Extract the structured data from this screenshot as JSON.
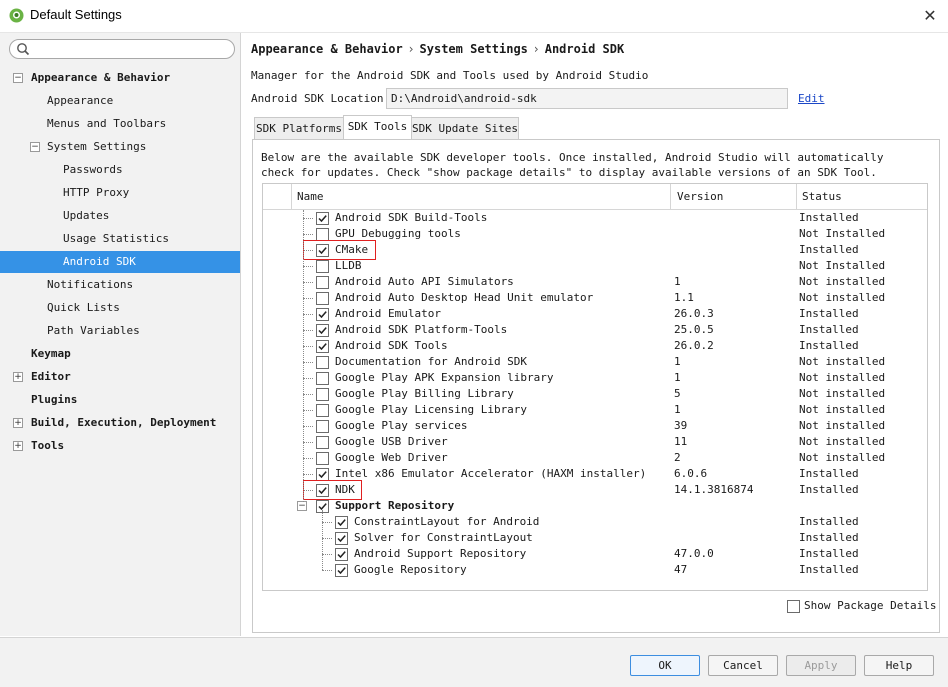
{
  "window": {
    "title": "Default Settings",
    "close_glyph": "✕"
  },
  "sidebar": {
    "search_placeholder": "",
    "items": [
      {
        "label": "Appearance & Behavior",
        "indent": 0,
        "bold": true,
        "expander": "−"
      },
      {
        "label": "Appearance",
        "indent": 1
      },
      {
        "label": "Menus and Toolbars",
        "indent": 1
      },
      {
        "label": "System Settings",
        "indent": 1,
        "expander": "−"
      },
      {
        "label": "Passwords",
        "indent": 2
      },
      {
        "label": "HTTP Proxy",
        "indent": 2
      },
      {
        "label": "Updates",
        "indent": 2
      },
      {
        "label": "Usage Statistics",
        "indent": 2
      },
      {
        "label": "Android SDK",
        "indent": 2,
        "selected": true
      },
      {
        "label": "Notifications",
        "indent": 1
      },
      {
        "label": "Quick Lists",
        "indent": 1
      },
      {
        "label": "Path Variables",
        "indent": 1
      },
      {
        "label": "Keymap",
        "indent": 0,
        "bold": true
      },
      {
        "label": "Editor",
        "indent": 0,
        "bold": true,
        "expander": "+"
      },
      {
        "label": "Plugins",
        "indent": 0,
        "bold": true
      },
      {
        "label": "Build, Execution, Deployment",
        "indent": 0,
        "bold": true,
        "expander": "+"
      },
      {
        "label": "Tools",
        "indent": 0,
        "bold": true,
        "expander": "+"
      }
    ]
  },
  "breadcrumb": [
    "Appearance & Behavior",
    "System Settings",
    "Android SDK"
  ],
  "breadcrumb_sep": "›",
  "description": "Manager for the Android SDK and Tools used by Android Studio",
  "sdk_location": {
    "label": "Android SDK Location:",
    "value": "D:\\Android\\android-sdk",
    "edit": "Edit"
  },
  "tabs": [
    {
      "label": "SDK Platforms",
      "active": false
    },
    {
      "label": "SDK Tools",
      "active": true
    },
    {
      "label": "SDK Update Sites",
      "active": false
    }
  ],
  "panel_desc": [
    "Below are the available SDK developer tools. Once installed, Android Studio will automatically",
    "check for updates. Check \"show package details\" to display available versions of an SDK Tool."
  ],
  "table": {
    "headers": {
      "name": "Name",
      "version": "Version",
      "status": "Status"
    },
    "rows": [
      {
        "name": "Android SDK Build-Tools",
        "version": "",
        "status": "Installed",
        "checked": true,
        "level": 0
      },
      {
        "name": "GPU Debugging tools",
        "version": "",
        "status": "Not Installed",
        "checked": false,
        "level": 0
      },
      {
        "name": "CMake",
        "version": "",
        "status": "Installed",
        "checked": true,
        "level": 0,
        "highlight": true
      },
      {
        "name": "LLDB",
        "version": "",
        "status": "Not Installed",
        "checked": false,
        "level": 0
      },
      {
        "name": "Android Auto API Simulators",
        "version": "1",
        "status": "Not installed",
        "checked": false,
        "level": 0
      },
      {
        "name": "Android Auto Desktop Head Unit emulator",
        "version": "1.1",
        "status": "Not installed",
        "checked": false,
        "level": 0
      },
      {
        "name": "Android Emulator",
        "version": "26.0.3",
        "status": "Installed",
        "checked": true,
        "level": 0
      },
      {
        "name": "Android SDK Platform-Tools",
        "version": "25.0.5",
        "status": "Installed",
        "checked": true,
        "level": 0
      },
      {
        "name": "Android SDK Tools",
        "version": "26.0.2",
        "status": "Installed",
        "checked": true,
        "level": 0
      },
      {
        "name": "Documentation for Android SDK",
        "version": "1",
        "status": "Not installed",
        "checked": false,
        "level": 0
      },
      {
        "name": "Google Play APK Expansion library",
        "version": "1",
        "status": "Not installed",
        "checked": false,
        "level": 0
      },
      {
        "name": "Google Play Billing Library",
        "version": "5",
        "status": "Not installed",
        "checked": false,
        "level": 0
      },
      {
        "name": "Google Play Licensing Library",
        "version": "1",
        "status": "Not installed",
        "checked": false,
        "level": 0
      },
      {
        "name": "Google Play services",
        "version": "39",
        "status": "Not installed",
        "checked": false,
        "level": 0
      },
      {
        "name": "Google USB Driver",
        "version": "11",
        "status": "Not installed",
        "checked": false,
        "level": 0
      },
      {
        "name": "Google Web Driver",
        "version": "2",
        "status": "Not installed",
        "checked": false,
        "level": 0
      },
      {
        "name": "Intel x86 Emulator Accelerator (HAXM installer)",
        "version": "6.0.6",
        "status": "Installed",
        "checked": true,
        "level": 0
      },
      {
        "name": "NDK",
        "version": "14.1.3816874",
        "status": "Installed",
        "checked": true,
        "level": 0,
        "highlight": true
      },
      {
        "name": "Support Repository",
        "version": "",
        "status": "",
        "checked": true,
        "level": 0,
        "bold": true,
        "expander": "−"
      },
      {
        "name": "ConstraintLayout for Android",
        "version": "",
        "status": "Installed",
        "checked": true,
        "level": 1
      },
      {
        "name": "Solver for ConstraintLayout",
        "version": "",
        "status": "Installed",
        "checked": true,
        "level": 1
      },
      {
        "name": "Android Support Repository",
        "version": "47.0.0",
        "status": "Installed",
        "checked": true,
        "level": 1
      },
      {
        "name": "Google Repository",
        "version": "47",
        "status": "Installed",
        "checked": true,
        "level": 1
      }
    ]
  },
  "show_package_details": {
    "label": "Show Package Details",
    "checked": false
  },
  "buttons": {
    "ok": "OK",
    "cancel": "Cancel",
    "apply": "Apply",
    "help": "Help"
  },
  "colors": {
    "selection": "#3592e6",
    "highlight_box": "#e02020",
    "link": "#1b47c7"
  }
}
